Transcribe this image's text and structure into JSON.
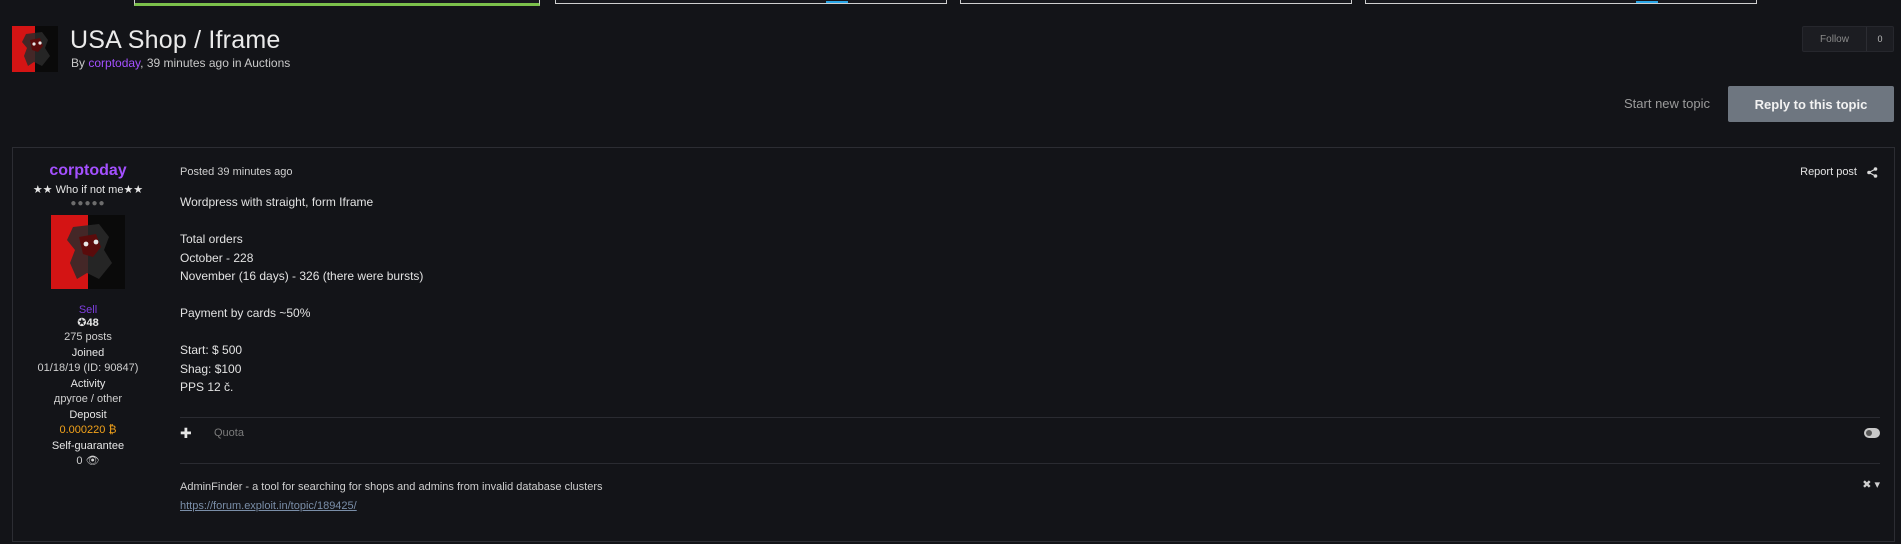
{
  "topic": {
    "title": "USA Shop / Iframe",
    "by_prefix": "By",
    "author": "corptoday",
    "meta_suffix": ", 39 minutes ago in Auctions",
    "follow_label": "Follow",
    "follow_count": "0"
  },
  "actions": {
    "start_new_topic": "Start new topic",
    "reply": "Reply to this topic"
  },
  "post": {
    "author": {
      "name": "corptoday",
      "rank": "★★ Who if not me★★",
      "pips": "●●●●●",
      "group": "Sell",
      "reputation": "✪48",
      "posts": "275 posts",
      "joined_label": "Joined",
      "joined_value": "01/18/19 (ID: 90847)",
      "activity_label": "Activity",
      "activity_value": "другое / other",
      "deposit_label": "Deposit",
      "deposit_value": "0.000220 ₿",
      "guarantee_label": "Self-guarantee",
      "guarantee_value": "0 👁"
    },
    "posted": "Posted 39 minutes ago",
    "report": "Report post",
    "share_icon": "share-icon",
    "body": {
      "line1": "Wordpress with straight, form Iframe",
      "line2": "Total orders",
      "line3": "October - 228",
      "line4": "November (16 days) - 326 (there were bursts)",
      "line5": "Payment by cards ~50%",
      "line6": "Start: $ 500",
      "line7": "Shag: $100",
      "line8": "PPS 12 č."
    },
    "quote_label": "Quota",
    "signature": {
      "text": "AdminFinder - a tool for searching for shops and admins from invalid database clusters",
      "link": "https://forum.exploit.in/topic/189425/"
    },
    "signature_tools": "✖ ▾"
  },
  "colors": {
    "background": "#131418",
    "username": "#a450ff",
    "reply_button": "#6e7680",
    "deposit": "#f2a21a"
  }
}
